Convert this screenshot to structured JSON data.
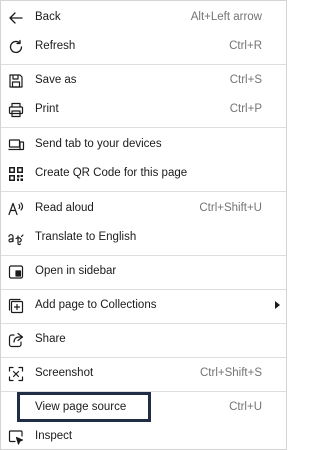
{
  "menu": {
    "items": [
      {
        "label": "Back",
        "shortcut": "Alt+Left arrow",
        "icon": "back-arrow-icon"
      },
      {
        "label": "Refresh",
        "shortcut": "Ctrl+R",
        "icon": "refresh-icon"
      },
      {
        "label": "Save as",
        "shortcut": "Ctrl+S",
        "icon": "save-icon"
      },
      {
        "label": "Print",
        "shortcut": "Ctrl+P",
        "icon": "print-icon"
      },
      {
        "label": "Send tab to your devices",
        "shortcut": "",
        "icon": "send-tab-icon"
      },
      {
        "label": "Create QR Code for this page",
        "shortcut": "",
        "icon": "qr-code-icon"
      },
      {
        "label": "Read aloud",
        "shortcut": "Ctrl+Shift+U",
        "icon": "read-aloud-icon"
      },
      {
        "label": "Translate to English",
        "shortcut": "",
        "icon": "translate-icon"
      },
      {
        "label": "Open in sidebar",
        "shortcut": "",
        "icon": "sidebar-icon"
      },
      {
        "label": "Add page to Collections",
        "shortcut": "",
        "icon": "collections-icon",
        "has_submenu": true
      },
      {
        "label": "Share",
        "shortcut": "",
        "icon": "share-icon"
      },
      {
        "label": "Screenshot",
        "shortcut": "Ctrl+Shift+S",
        "icon": "screenshot-icon"
      },
      {
        "label": "View page source",
        "shortcut": "Ctrl+U",
        "icon": "",
        "highlighted": true
      },
      {
        "label": "Inspect",
        "shortcut": "",
        "icon": "inspect-icon"
      }
    ]
  },
  "colors": {
    "highlight_border": "#1f2d45",
    "shortcut_text": "#747474",
    "separator": "#dedede"
  }
}
